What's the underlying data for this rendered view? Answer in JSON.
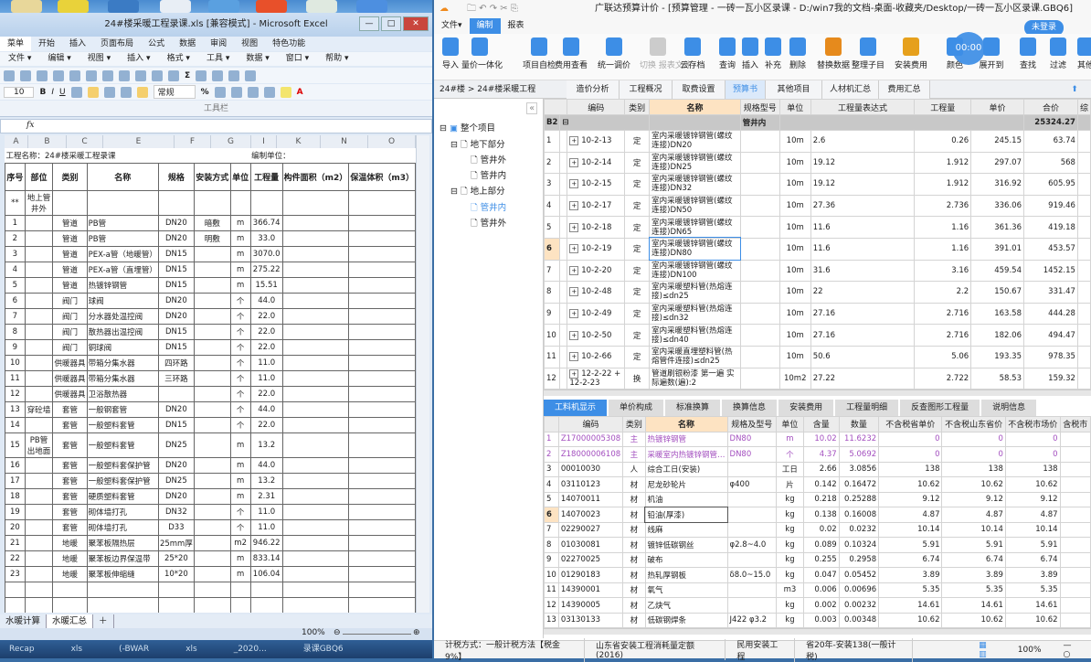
{
  "excel": {
    "title": "24#楼采暖工程录课.xls  [兼容模式] - Microsoft Excel",
    "tabs": [
      "菜单",
      "开始",
      "插入",
      "页面布局",
      "公式",
      "数据",
      "审阅",
      "视图",
      "特色功能"
    ],
    "menu": [
      "文件 ▾",
      "编辑 ▾",
      "视图 ▾",
      "插入 ▾",
      "格式 ▾",
      "工具 ▾",
      "数据 ▾",
      "窗口 ▾",
      "帮助 ▾"
    ],
    "font_size": "10",
    "number_format": "常规",
    "toolbar_label": "工具栏",
    "fx": "fx",
    "columns": [
      "A",
      "B",
      "C",
      "E",
      "F",
      "G",
      "I",
      "K",
      "N",
      "O"
    ],
    "project_name": "工程名称：24#楼采暖工程录课",
    "compiler": "编制单位：",
    "headers": [
      "序号",
      "部位",
      "类别",
      "名称",
      "规格",
      "安装方式",
      "单位",
      "工程量",
      "构件面积（m2）",
      "保温体积（m3）"
    ],
    "rows": [
      [
        "**",
        "地上管井外",
        "",
        "",
        "",
        "",
        "",
        "",
        "",
        ""
      ],
      [
        "1",
        "",
        "管道",
        "PB管",
        "DN20",
        "暗敷",
        "m",
        "366.74",
        "",
        ""
      ],
      [
        "2",
        "",
        "管道",
        "PB管",
        "DN20",
        "明敷",
        "m",
        "33.0",
        "",
        ""
      ],
      [
        "3",
        "",
        "管道",
        "PEX-a管（地暖管）",
        "DN15",
        "",
        "m",
        "3070.0",
        "",
        ""
      ],
      [
        "4",
        "",
        "管道",
        "PEX-a管（直埋管）",
        "DN15",
        "",
        "m",
        "275.22",
        "",
        ""
      ],
      [
        "5",
        "",
        "管道",
        "热镀锌钢管",
        "DN15",
        "",
        "m",
        "15.51",
        "",
        ""
      ],
      [
        "6",
        "",
        "阀门",
        "球阀",
        "DN20",
        "",
        "个",
        "44.0",
        "",
        ""
      ],
      [
        "7",
        "",
        "阀门",
        "分水器处温控阀",
        "DN20",
        "",
        "个",
        "22.0",
        "",
        ""
      ],
      [
        "8",
        "",
        "阀门",
        "散热器出温控阀",
        "DN15",
        "",
        "个",
        "22.0",
        "",
        ""
      ],
      [
        "9",
        "",
        "阀门",
        "铜球阀",
        "DN15",
        "",
        "个",
        "22.0",
        "",
        ""
      ],
      [
        "10",
        "",
        "供暖器具",
        "带箱分集水器",
        "四环路",
        "",
        "个",
        "11.0",
        "",
        ""
      ],
      [
        "11",
        "",
        "供暖器具",
        "带箱分集水器",
        "三环路",
        "",
        "个",
        "11.0",
        "",
        ""
      ],
      [
        "12",
        "",
        "供暖器具",
        "卫浴散热器",
        "",
        "",
        "个",
        "22.0",
        "",
        ""
      ],
      [
        "13",
        "穿砼墙",
        "套管",
        "一般钢套管",
        "DN20",
        "",
        "个",
        "44.0",
        "",
        ""
      ],
      [
        "14",
        "",
        "套管",
        "一般塑料套管",
        "DN15",
        "",
        "个",
        "22.0",
        "",
        ""
      ],
      [
        "15",
        "PB管出地面",
        "套管",
        "一般塑料套管",
        "DN25",
        "",
        "m",
        "13.2",
        "",
        ""
      ],
      [
        "16",
        "",
        "套管",
        "一般塑料套保护管",
        "DN20",
        "",
        "m",
        "44.0",
        "",
        ""
      ],
      [
        "17",
        "",
        "套管",
        "一般塑料套保护管",
        "DN25",
        "",
        "m",
        "13.2",
        "",
        ""
      ],
      [
        "18",
        "",
        "套管",
        "硬质塑料套管",
        "DN20",
        "",
        "m",
        "2.31",
        "",
        ""
      ],
      [
        "19",
        "",
        "套管",
        "砌体墙打孔",
        "DN32",
        "",
        "个",
        "11.0",
        "",
        ""
      ],
      [
        "20",
        "",
        "套管",
        "砌体墙打孔",
        "D33",
        "",
        "个",
        "11.0",
        "",
        ""
      ],
      [
        "21",
        "",
        "地暖",
        "聚苯板隔热层",
        "25mm厚",
        "",
        "m2",
        "946.22",
        "",
        ""
      ],
      [
        "22",
        "",
        "地暖",
        "聚苯板边界保温带",
        "25*20",
        "",
        "m",
        "833.14",
        "",
        ""
      ],
      [
        "23",
        "",
        "地暖",
        "聚苯板伸缩缝",
        "10*20",
        "",
        "m",
        "106.04",
        "",
        ""
      ]
    ],
    "sheet_tabs": [
      "水暖计算",
      "水暖汇总"
    ],
    "zoom": "100%",
    "taskbar": [
      "Recap",
      "xls",
      "(-BWAR",
      "xls",
      "_2020...",
      "录课GBQ6"
    ]
  },
  "glodon": {
    "title": "广联达预算计价 - [预算管理 - 一砖一瓦小区录课 - D:/win7我的文档-桌面-收藏夹/Desktop/一砖一瓦小区录课.GBQ6]",
    "menu": [
      "文件▾",
      "编制",
      "报表"
    ],
    "login": "未登录",
    "ribbon": [
      "导入",
      "量价一体化",
      "项目自检",
      "费用查看",
      "统一调价",
      "切换 报表文件",
      "云存档",
      "查询",
      "插入",
      "补充",
      "删除",
      "替换数据",
      "整理子目",
      "安装费用",
      "颜色",
      "展开到",
      "查找",
      "过滤",
      "其他",
      "工具"
    ],
    "timer": "00:00",
    "breadcrumb": "24#楼 > 24#楼采暖工程",
    "nav_tabs": [
      "造价分析",
      "工程概况",
      "取费设置",
      "预算书",
      "其他项目",
      "人材机汇总",
      "费用汇总"
    ],
    "tree": [
      "整个项目",
      "地下部分",
      "管井外",
      "管井内",
      "地上部分",
      "管井内",
      "管井外"
    ],
    "main_headers": [
      "编码",
      "类别",
      "名称",
      "规格型号",
      "单位",
      "工程量表达式",
      "工程量",
      "单价",
      "合价",
      "综"
    ],
    "group": {
      "id": "B2",
      "name": "管井内",
      "total": "25324.27"
    },
    "main_rows": [
      [
        "1",
        "10-2-13",
        "定",
        "室内采暖镀锌钢管(螺纹连接)DN20",
        "",
        "10m",
        "2.6",
        "0.26",
        "245.15",
        "63.74"
      ],
      [
        "2",
        "10-2-14",
        "定",
        "室内采暖镀锌钢管(螺纹连接)DN25",
        "",
        "10m",
        "19.12",
        "1.912",
        "297.07",
        "568"
      ],
      [
        "3",
        "10-2-15",
        "定",
        "室内采暖镀锌钢管(螺纹连接)DN32",
        "",
        "10m",
        "19.12",
        "1.912",
        "316.92",
        "605.95"
      ],
      [
        "4",
        "10-2-17",
        "定",
        "室内采暖镀锌钢管(螺纹连接)DN50",
        "",
        "10m",
        "27.36",
        "2.736",
        "336.06",
        "919.46"
      ],
      [
        "5",
        "10-2-18",
        "定",
        "室内采暖镀锌钢管(螺纹连接)DN65",
        "",
        "10m",
        "11.6",
        "1.16",
        "361.36",
        "419.18"
      ],
      [
        "6",
        "10-2-19",
        "定",
        "室内采暖镀锌钢管(螺纹连接)DN80",
        "",
        "10m",
        "11.6",
        "1.16",
        "391.01",
        "453.57"
      ],
      [
        "7",
        "10-2-20",
        "定",
        "室内采暖镀锌钢管(螺纹连接)DN100",
        "",
        "10m",
        "31.6",
        "3.16",
        "459.54",
        "1452.15"
      ],
      [
        "8",
        "10-2-48",
        "定",
        "室内采暖塑料管(热熔连接)≤dn25",
        "",
        "10m",
        "22",
        "2.2",
        "150.67",
        "331.47"
      ],
      [
        "9",
        "10-2-49",
        "定",
        "室内采暖塑料管(热熔连接)≤dn32",
        "",
        "10m",
        "27.16",
        "2.716",
        "163.58",
        "444.28"
      ],
      [
        "10",
        "10-2-50",
        "定",
        "室内采暖塑料管(热熔连接)≤dn40",
        "",
        "10m",
        "27.16",
        "2.716",
        "182.06",
        "494.47"
      ],
      [
        "11",
        "10-2-66",
        "定",
        "室内采暖直埋塑料管(热熔管件连接)≤dn25",
        "",
        "10m",
        "50.6",
        "5.06",
        "193.35",
        "978.35"
      ],
      [
        "12",
        "12-2-22 + 12-2-23",
        "换",
        "管道刷银粉漆 第一遍 实际遍数(遍):2",
        "",
        "10m2",
        "27.22",
        "2.722",
        "58.53",
        "159.32"
      ]
    ],
    "bottom_tabs": [
      "工料机显示",
      "单价构成",
      "标准换算",
      "换算信息",
      "安装费用",
      "工程量明细",
      "反查图形工程量",
      "说明信息"
    ],
    "bottom_headers": [
      "编码",
      "类别",
      "名称",
      "规格及型号",
      "单位",
      "含量",
      "数量",
      "不含税省单价",
      "不含税山东省价",
      "不含税市场价",
      "含税市"
    ],
    "bottom_rows": [
      [
        "1",
        "Z17000005308",
        "主",
        "热镀锌钢管",
        "DN80",
        "m",
        "10.02",
        "11.6232",
        "0",
        "0",
        "0"
      ],
      [
        "2",
        "Z18000006108",
        "主",
        "采暖室内热镀锌钢管…",
        "DN80",
        "个",
        "4.37",
        "5.0692",
        "0",
        "0",
        "0"
      ],
      [
        "3",
        "00010030",
        "人",
        "综合工日(安装)",
        "",
        "工日",
        "2.66",
        "3.0856",
        "138",
        "138",
        "138"
      ],
      [
        "4",
        "03110123",
        "材",
        "尼龙砂轮片",
        "φ400",
        "片",
        "0.142",
        "0.16472",
        "10.62",
        "10.62",
        "10.62"
      ],
      [
        "5",
        "14070011",
        "材",
        "机油",
        "",
        "kg",
        "0.218",
        "0.25288",
        "9.12",
        "9.12",
        "9.12"
      ],
      [
        "6",
        "14070023",
        "材",
        "铅油(厚漆)",
        "",
        "kg",
        "0.138",
        "0.16008",
        "4.87",
        "4.87",
        "4.87"
      ],
      [
        "7",
        "02290027",
        "材",
        "线麻",
        "",
        "kg",
        "0.02",
        "0.0232",
        "10.14",
        "10.14",
        "10.14"
      ],
      [
        "8",
        "01030081",
        "材",
        "镀锌低碳钢丝",
        "φ2.8~4.0",
        "kg",
        "0.089",
        "0.10324",
        "5.91",
        "5.91",
        "5.91"
      ],
      [
        "9",
        "02270025",
        "材",
        "破布",
        "",
        "kg",
        "0.255",
        "0.2958",
        "6.74",
        "6.74",
        "6.74"
      ],
      [
        "10",
        "01290183",
        "材",
        "热轧厚钢板",
        "δ8.0~15.0",
        "kg",
        "0.047",
        "0.05452",
        "3.89",
        "3.89",
        "3.89"
      ],
      [
        "11",
        "14390001",
        "材",
        "氧气",
        "",
        "m3",
        "0.006",
        "0.00696",
        "5.35",
        "5.35",
        "5.35"
      ],
      [
        "12",
        "14390005",
        "材",
        "乙炔气",
        "",
        "kg",
        "0.002",
        "0.00232",
        "14.61",
        "14.61",
        "14.61"
      ],
      [
        "13",
        "03130133",
        "材",
        "低碳钢焊条",
        "J422 φ3.2",
        "kg",
        "0.003",
        "0.00348",
        "10.62",
        "10.62",
        "10.62"
      ]
    ],
    "status": [
      "计税方式：一般计税方法【税金9%】",
      "山东省安装工程消耗量定额(2016)",
      "民用安装工程",
      "省20年-安装138(一般计税)",
      "100%"
    ]
  }
}
